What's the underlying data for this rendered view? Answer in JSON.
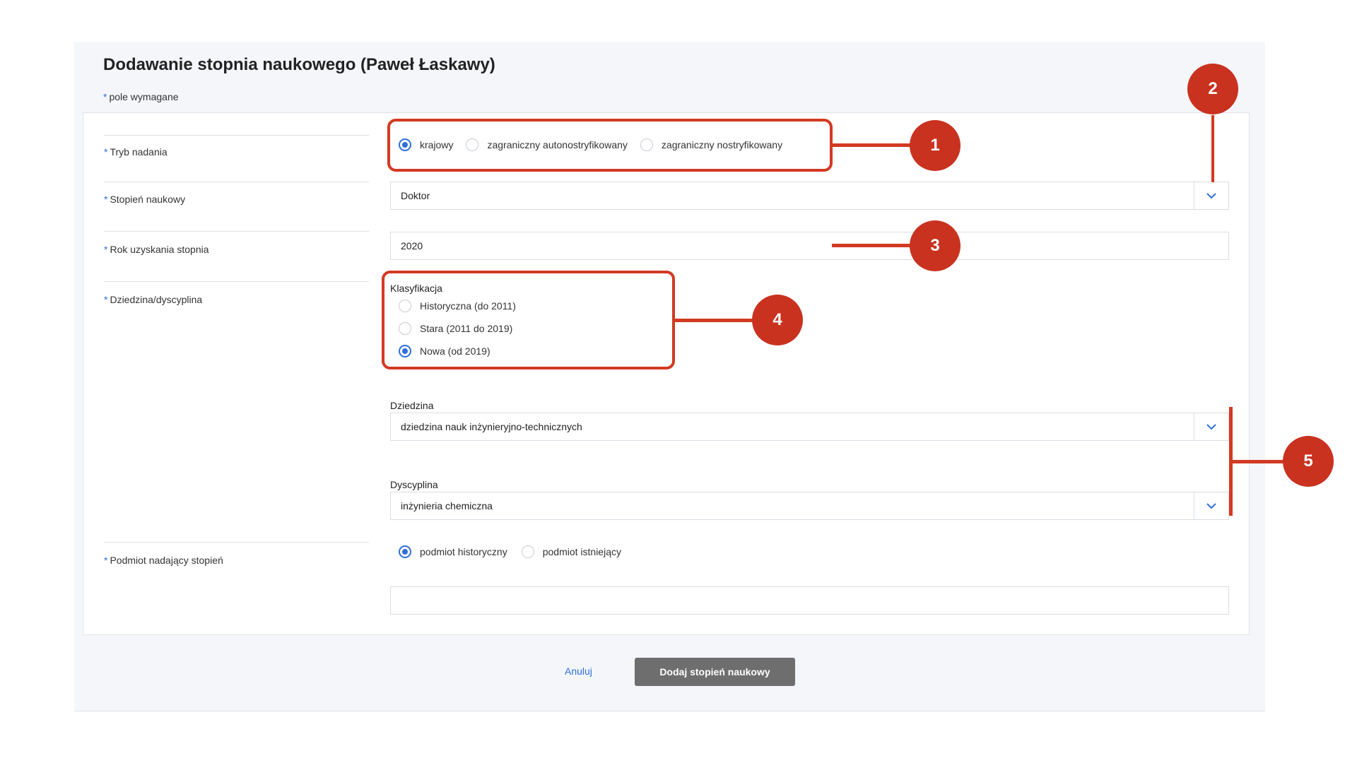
{
  "form": {
    "title": "Dodawanie stopnia naukowego (Paweł Łaskawy)",
    "required_marker": "*",
    "required_note": "pole wymagane"
  },
  "fields": {
    "tryb": {
      "label": "Tryb nadania",
      "options": [
        "krajowy",
        "zagraniczny autonostryfikowany",
        "zagraniczny nostryfikowany"
      ],
      "selected": "krajowy"
    },
    "stopien": {
      "label": "Stopień naukowy",
      "value": "Doktor"
    },
    "rok": {
      "label": "Rok uzyskania stopnia",
      "value": "2020"
    },
    "dziedzina_dyscyplina": {
      "label": "Dziedzina/dyscyplina",
      "klasyfikacja_label": "Klasyfikacja",
      "klasyfikacja_options": [
        "Historyczna (do 2011)",
        "Stara (2011 do 2019)",
        "Nowa (od 2019)"
      ],
      "klasyfikacja_selected": "Nowa (od 2019)",
      "dziedzina_label": "Dziedzina",
      "dziedzina_value": "dziedzina nauk inżynieryjno-technicznych",
      "dyscyplina_label": "Dyscyplina",
      "dyscyplina_value": "inżynieria chemiczna"
    },
    "podmiot": {
      "label": "Podmiot nadający stopień",
      "options": [
        "podmiot historyczny",
        "podmiot istniejący"
      ],
      "selected": "podmiot historyczny",
      "value": ""
    }
  },
  "actions": {
    "cancel_label": "Anuluj",
    "submit_label": "Dodaj stopień naukowy"
  },
  "annotations": [
    "1",
    "2",
    "3",
    "4",
    "5"
  ],
  "colors": {
    "accent": "#2f6fdc",
    "annotation": "#c9321f",
    "submit_bg": "#6e6e6e"
  }
}
